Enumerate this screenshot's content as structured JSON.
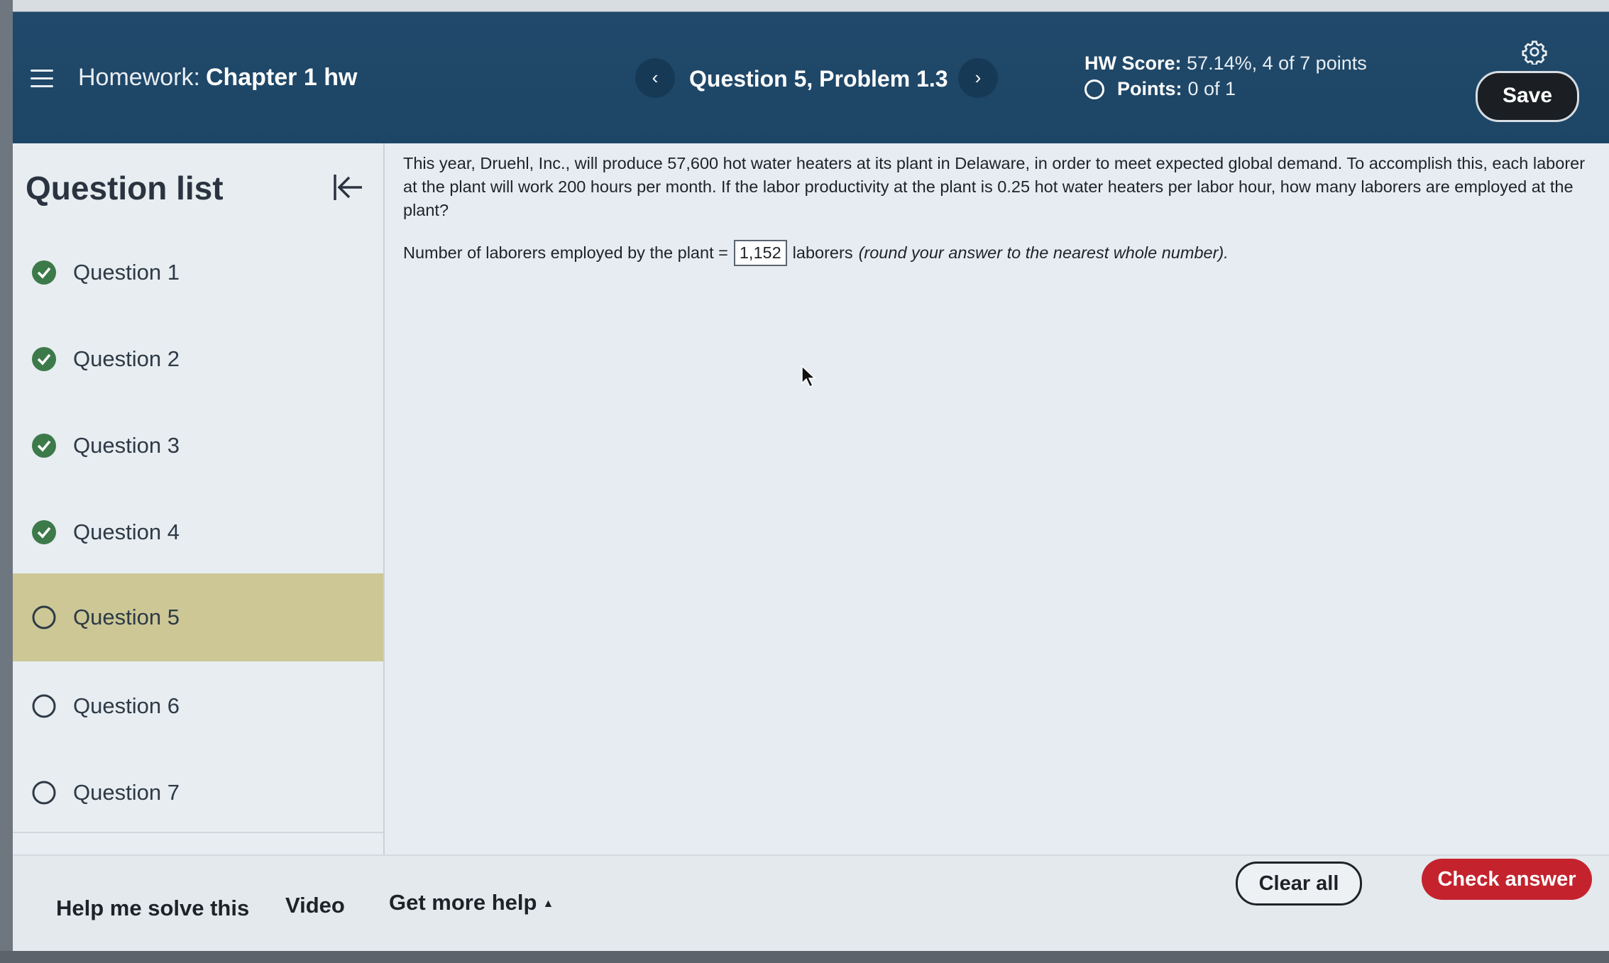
{
  "header": {
    "menu_icon": "hamburger-icon",
    "homework_prefix": "Homework:",
    "homework_name": "Chapter 1 hw",
    "prev_label": "‹",
    "next_label": "›",
    "question_title": "Question 5, Problem 1.3",
    "score_label": "HW Score:",
    "score_value": "57.14%, 4 of 7 points",
    "points_label": "Points:",
    "points_value": "0 of 1",
    "save_label": "Save",
    "settings_icon": "gear-icon"
  },
  "sidebar": {
    "title": "Question list",
    "collapse_icon": "collapse-left-icon",
    "items": [
      {
        "label": "Question 1",
        "status": "complete"
      },
      {
        "label": "Question 2",
        "status": "complete"
      },
      {
        "label": "Question 3",
        "status": "complete"
      },
      {
        "label": "Question 4",
        "status": "complete"
      },
      {
        "label": "Question 5",
        "status": "current"
      },
      {
        "label": "Question 6",
        "status": "incomplete"
      },
      {
        "label": "Question 7",
        "status": "incomplete"
      }
    ]
  },
  "problem": {
    "text": "This year, Druehl, Inc., will produce 57,600 hot water heaters at its plant in Delaware, in order to meet expected global demand. To accomplish this, each laborer at the plant will work 200 hours per month. If the labor productivity at the plant is 0.25 hot water heaters per labor hour, how many laborers are employed at the plant?",
    "answer_prefix": "Number of laborers employed by the plant =",
    "answer_value": "1,152",
    "answer_unit": "laborers",
    "answer_hint": "(round your answer to the nearest whole number)."
  },
  "footer": {
    "help_label": "Help me solve this",
    "video_label": "Video",
    "more_help_label": "Get more help",
    "more_help_caret": "▲",
    "clear_label": "Clear all",
    "check_label": "Check answer"
  },
  "colors": {
    "header_bg": "#1d4565",
    "active_question_bg": "#ccc795",
    "complete_check": "#3d7a4a",
    "check_answer_bg": "#c4232d"
  }
}
